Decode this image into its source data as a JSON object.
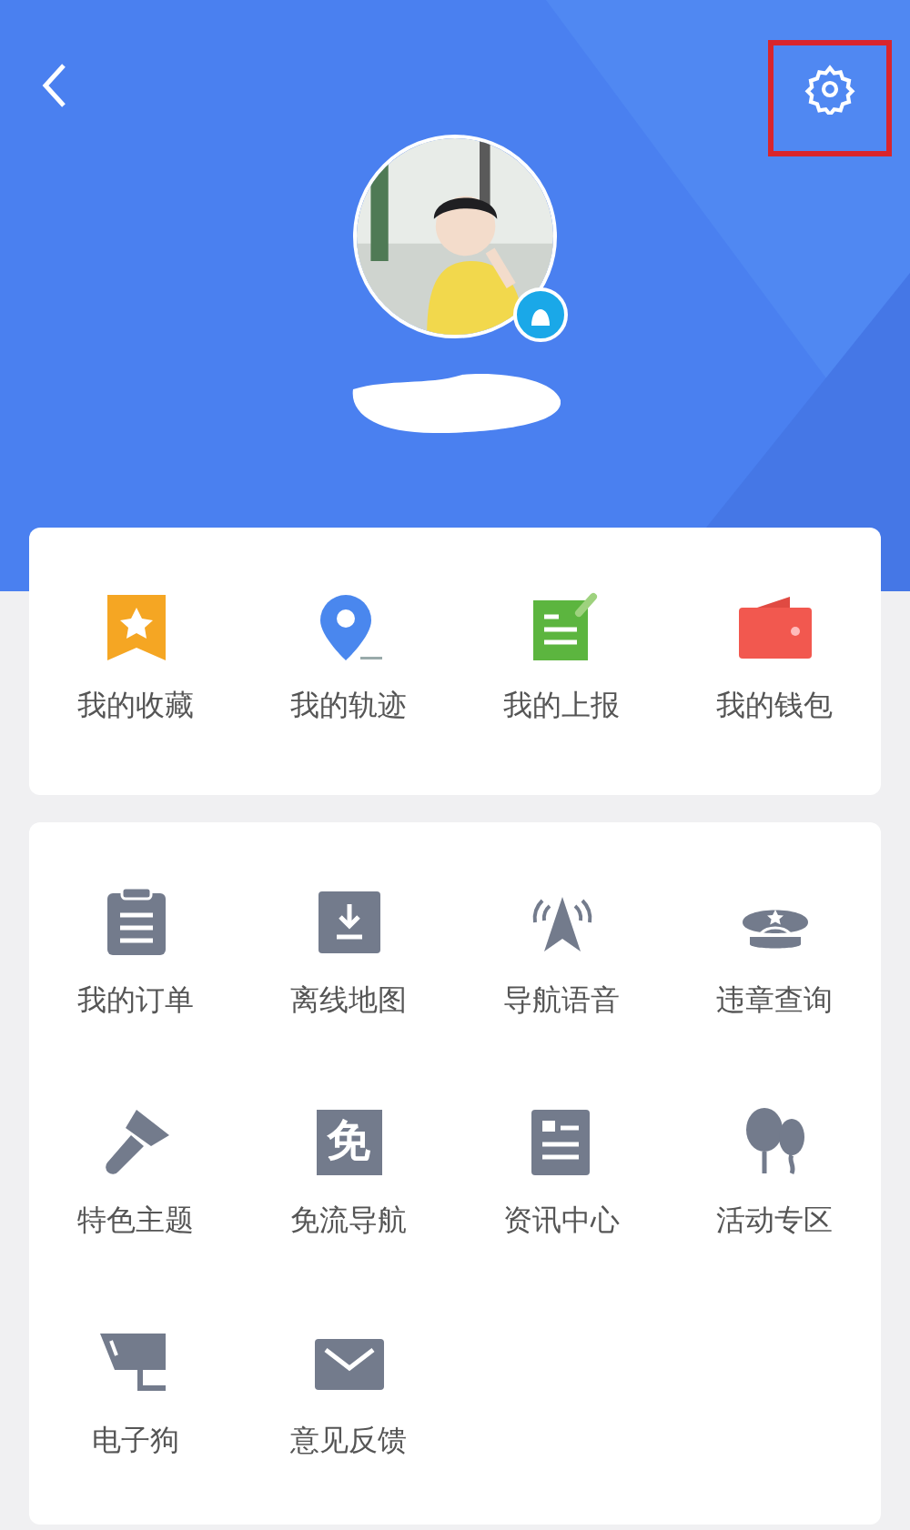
{
  "header": {
    "settings_highlighted": true
  },
  "quick_menu": [
    {
      "label": "我的收藏",
      "kind": "favorite"
    },
    {
      "label": "我的轨迹",
      "kind": "track"
    },
    {
      "label": "我的上报",
      "kind": "report"
    },
    {
      "label": "我的钱包",
      "kind": "wallet"
    }
  ],
  "tools_menu": [
    {
      "label": "我的订单",
      "kind": "order"
    },
    {
      "label": "离线地图",
      "kind": "download"
    },
    {
      "label": "导航语音",
      "kind": "voice"
    },
    {
      "label": "违章查询",
      "kind": "police"
    },
    {
      "label": "特色主题",
      "kind": "brush"
    },
    {
      "label": "免流导航",
      "kind": "free",
      "icon_text": "免"
    },
    {
      "label": "资讯中心",
      "kind": "news"
    },
    {
      "label": "活动专区",
      "kind": "balloon"
    },
    {
      "label": "电子狗",
      "kind": "camera"
    },
    {
      "label": "意见反馈",
      "kind": "mail"
    }
  ]
}
